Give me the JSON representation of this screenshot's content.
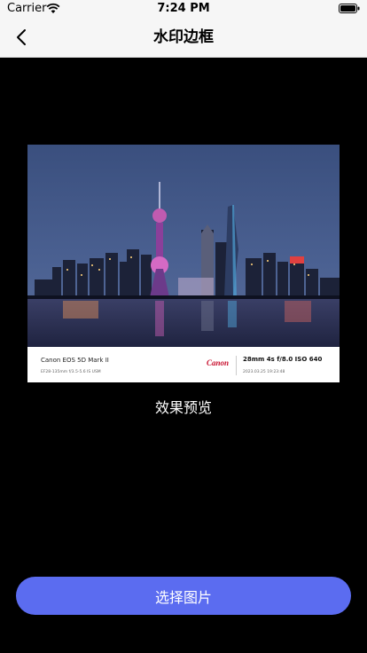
{
  "status_bar": {
    "carrier": "Carrier",
    "time": "7:24 PM",
    "icons": [
      "wifi-icon",
      "battery-icon"
    ]
  },
  "nav": {
    "title": "水印边框",
    "back_icon": "chevron-left-icon"
  },
  "preview": {
    "camera_model": "Canon EOS 5D Mark II",
    "lens": "EF28-135mm f/3.5-5.6 IS USM",
    "brand": "Canon",
    "exif": "28mm  4s  f/8.0 ISO 640",
    "date": "2023.03.25 19:23:48",
    "label": "效果预览"
  },
  "actions": {
    "select_label": "选择图片"
  },
  "colors": {
    "accent": "#5b6cf0",
    "background": "#000000",
    "brand_red": "#c8102e"
  }
}
